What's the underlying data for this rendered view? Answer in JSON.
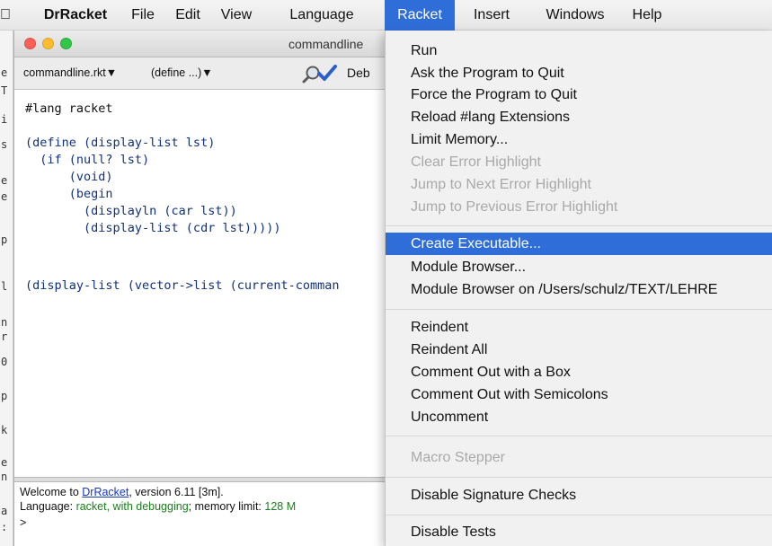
{
  "menubar": {
    "app_name": "DrRacket",
    "items": [
      "File",
      "Edit",
      "View",
      "Language",
      "Racket",
      "Insert",
      "Windows",
      "Help"
    ],
    "active_item": "Racket",
    "active_color": "#2f6dd8"
  },
  "window": {
    "title": "commandline",
    "toolbar": {
      "file_popup": "commandline.rkt▼",
      "define_popup": "(define ...)▼",
      "debug_label": "Deb"
    }
  },
  "editor": {
    "lines": [
      "#lang racket",
      "",
      "(define (display-list lst)",
      "  (if (null? lst)",
      "      (void)",
      "      (begin",
      "        (displayln (car lst))",
      "        (display-list (cdr lst)))))",
      "",
      "",
      "",
      "(display-list (vector->list (current-comman"
    ]
  },
  "repl": {
    "welcome_prefix": "Welcome to ",
    "welcome_link": "DrRacket",
    "welcome_suffix": ", version 6.11 [3m].",
    "language_prefix": "Language: ",
    "language_value": "racket, with debugging",
    "memory_prefix": "; memory limit: ",
    "memory_value": "128 M",
    "prompt": ">"
  },
  "racket_menu": {
    "items": [
      {
        "label": "Run",
        "enabled": true
      },
      {
        "label": "Ask the Program to Quit",
        "enabled": true
      },
      {
        "label": "Force the Program to Quit",
        "enabled": true
      },
      {
        "label": "Reload #lang Extensions",
        "enabled": true
      },
      {
        "label": "Limit Memory...",
        "enabled": true
      },
      {
        "label": "Clear Error Highlight",
        "enabled": false
      },
      {
        "label": "Jump to Next Error Highlight",
        "enabled": false
      },
      {
        "label": "Jump to Previous Error Highlight",
        "enabled": false
      },
      {
        "label": "Create Executable...",
        "enabled": true,
        "selected": true
      },
      {
        "label": "Module Browser...",
        "enabled": true
      },
      {
        "label": "Module Browser on /Users/schulz/TEXT/LEHRE",
        "enabled": true
      },
      {
        "label": "Reindent",
        "enabled": true
      },
      {
        "label": "Reindent All",
        "enabled": true
      },
      {
        "label": "Comment Out with a Box",
        "enabled": true
      },
      {
        "label": "Comment Out with Semicolons",
        "enabled": true
      },
      {
        "label": "Uncomment",
        "enabled": true
      },
      {
        "label": "Macro Stepper",
        "enabled": false
      },
      {
        "label": "Disable Signature Checks",
        "enabled": true
      },
      {
        "label": "Disable Tests",
        "enabled": true
      }
    ]
  }
}
